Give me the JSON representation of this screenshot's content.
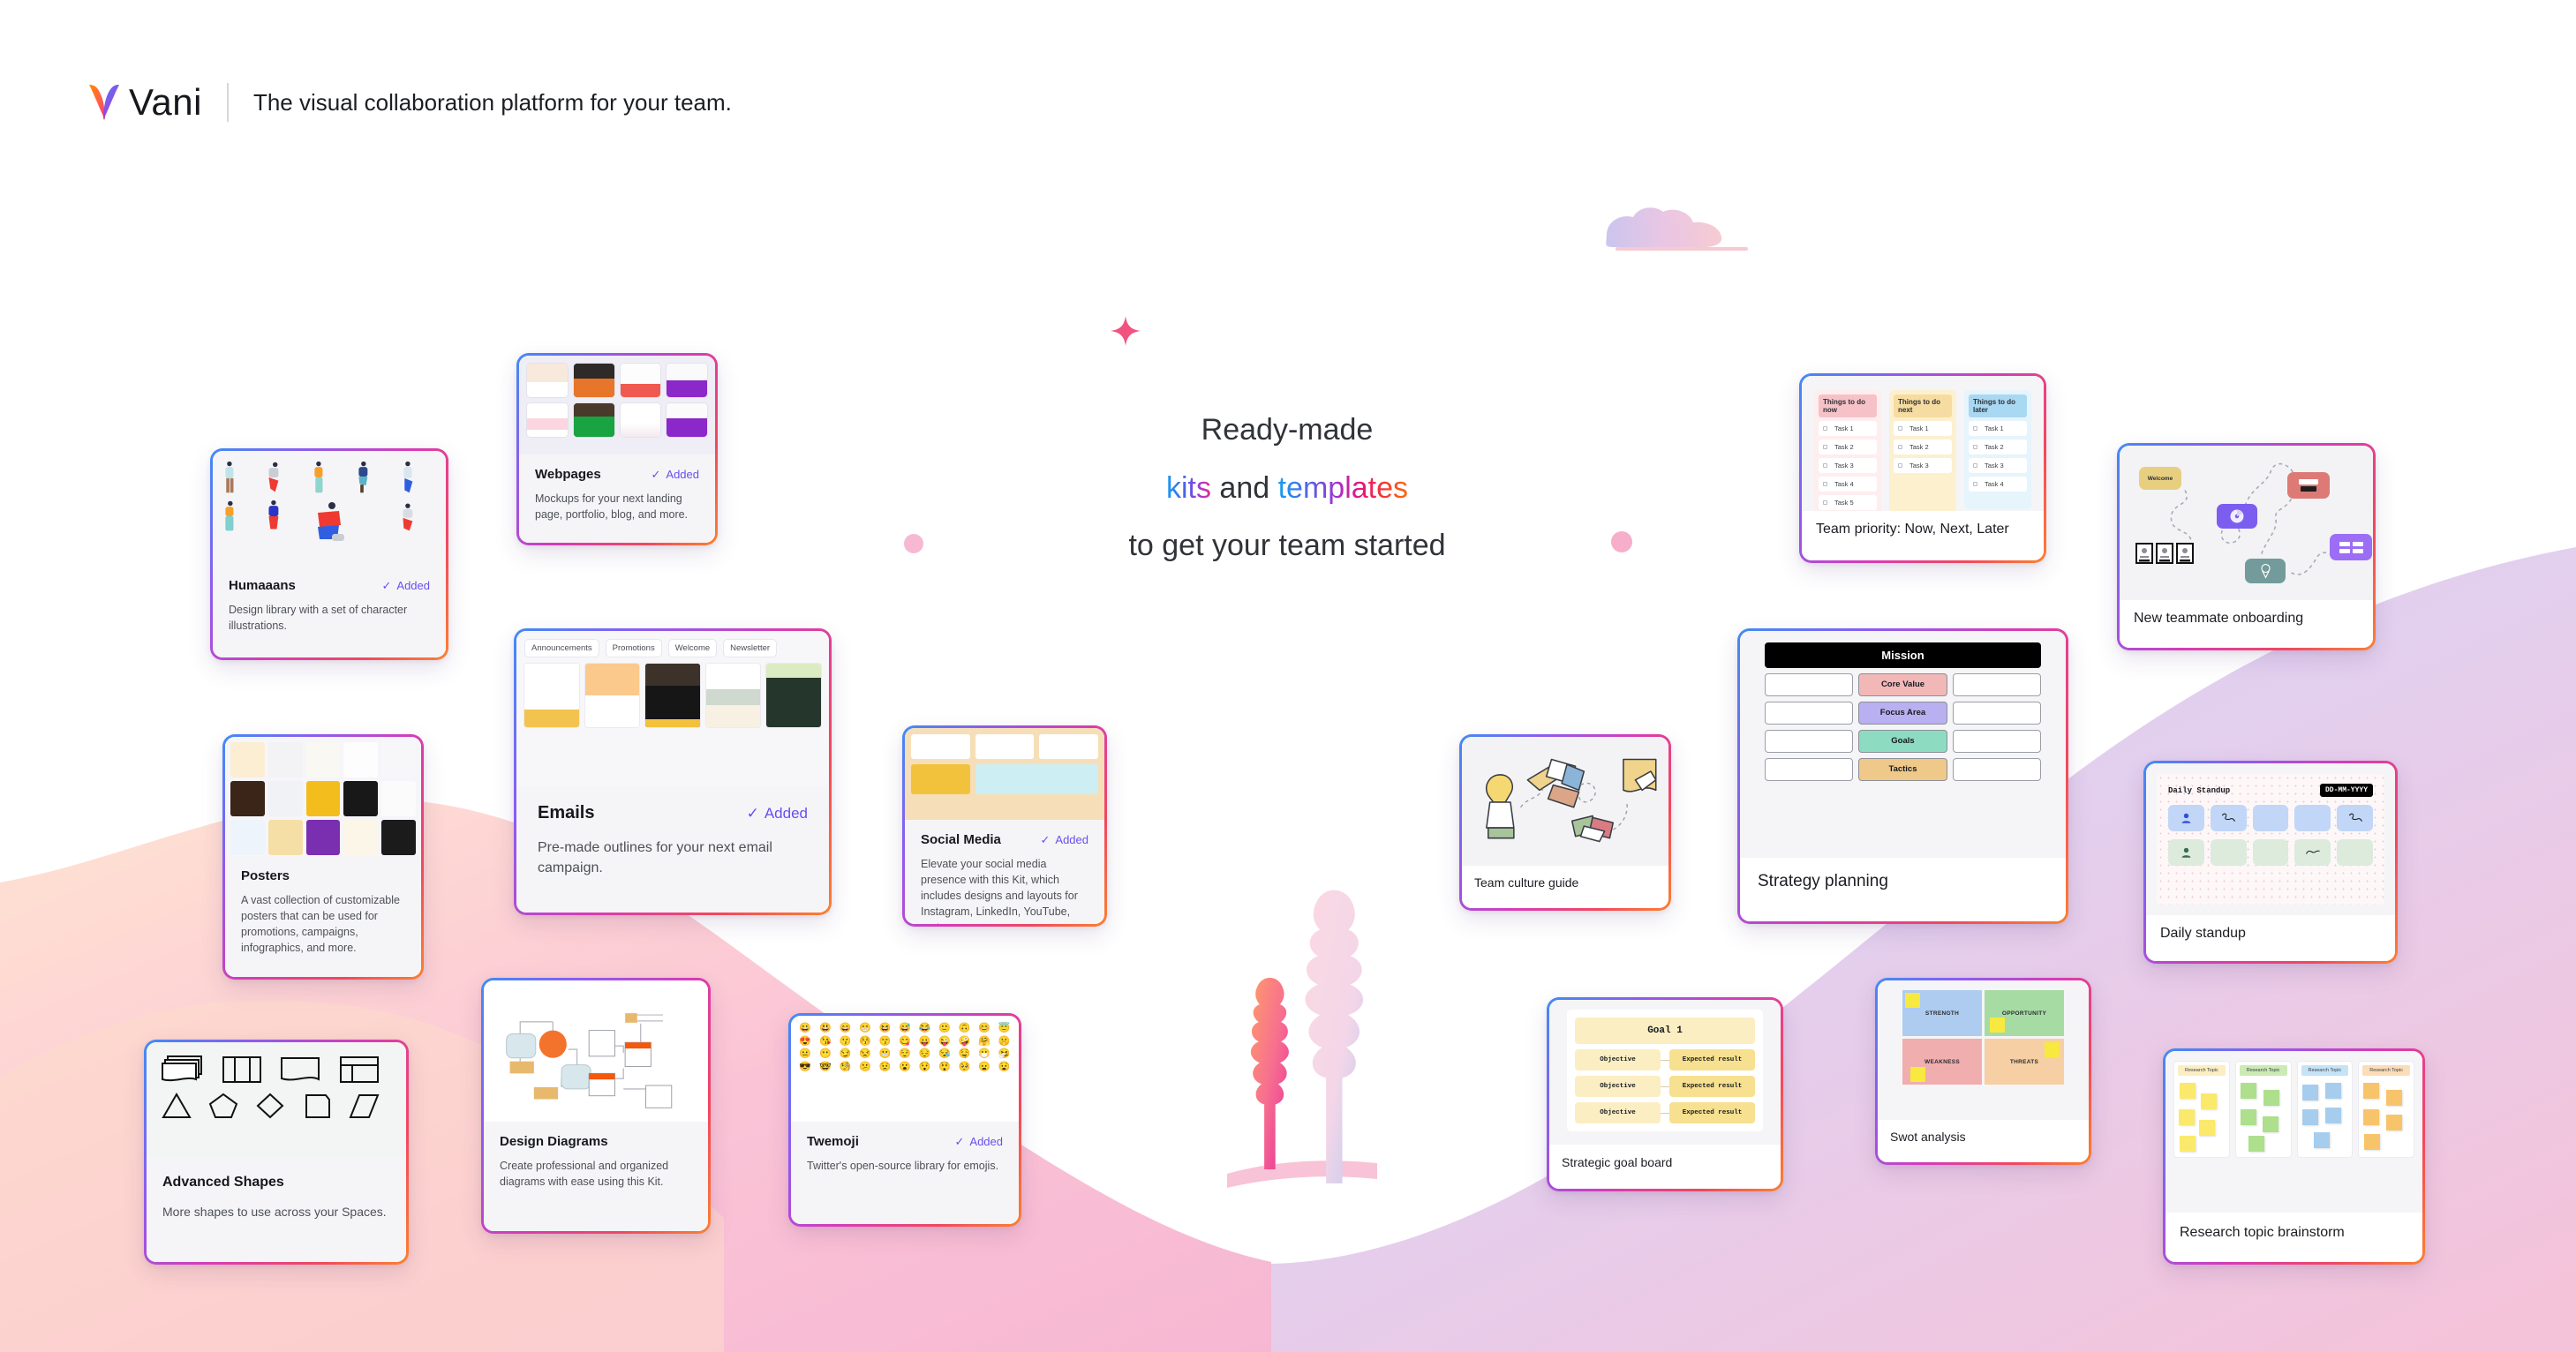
{
  "header": {
    "logo_text": "Vani",
    "tagline": "The visual collaboration platform for your team."
  },
  "hero": {
    "line1": "Ready-made",
    "line2_a": "kits",
    "line2_b": "and",
    "line2_c": "templates",
    "line3": "to get your team started"
  },
  "labels": {
    "added": "Added",
    "check": "✓"
  },
  "kits": [
    {
      "name": "humaaans",
      "title": "Humaaans",
      "desc": "Design library with a set of character illustrations.",
      "added": true
    },
    {
      "name": "webpages",
      "title": "Webpages",
      "desc": "Mockups for your next landing page, portfolio, blog, and more.",
      "added": true
    },
    {
      "name": "emails",
      "title": "Emails",
      "desc": "Pre-made outlines for your next email campaign.",
      "added": true,
      "tabs": [
        "Announcements",
        "Promotions",
        "Welcome",
        "Newsletter"
      ]
    },
    {
      "name": "posters",
      "title": "Posters",
      "desc": "A vast collection of customizable posters that can be used for promotions, campaigns, infographics, and more.",
      "added": false
    },
    {
      "name": "social-media",
      "title": "Social Media",
      "desc": "Elevate your social media presence with this Kit, which includes designs and layouts for Instagram, LinkedIn, YouTube, and more.",
      "added": true
    },
    {
      "name": "advanced-shapes",
      "title": "Advanced Shapes",
      "desc": "More shapes to use across your Spaces.",
      "added": false
    },
    {
      "name": "design-diagrams",
      "title": "Design Diagrams",
      "desc": "Create professional and organized diagrams with ease using this Kit.",
      "added": false
    },
    {
      "name": "twemoji",
      "title": "Twemoji",
      "desc": "Twitter's open-source library for emojis.",
      "added": true
    }
  ],
  "templates": [
    {
      "name": "team-priority",
      "title": "Team priority: Now, Next, Later"
    },
    {
      "name": "new-teammate-onboarding",
      "title": "New teammate onboarding"
    },
    {
      "name": "strategy-planning",
      "title": "Strategy planning"
    },
    {
      "name": "team-culture-guide",
      "title": "Team culture guide"
    },
    {
      "name": "daily-standup",
      "title": "Daily standup"
    },
    {
      "name": "strategic-goal-board",
      "title": "Strategic goal board"
    },
    {
      "name": "swot-analysis",
      "title": "Swot analysis"
    },
    {
      "name": "research-topic-brainstorm",
      "title": "Research topic brainstorm"
    }
  ],
  "priority_board": {
    "columns": [
      {
        "header": "Things to do now",
        "color": "#f6c2c8",
        "body": "#fdeef0",
        "tasks": [
          "Task 1",
          "Task 2",
          "Task 3",
          "Task 4",
          "Task 5"
        ]
      },
      {
        "header": "Things to do next",
        "color": "#f6dca0",
        "body": "#fdf0cf",
        "tasks": [
          "Task 1",
          "Task 2",
          "Task 3"
        ]
      },
      {
        "header": "Things to do later",
        "color": "#a9d8f2",
        "body": "#e6f4fc",
        "tasks": [
          "Task 1",
          "Task 2",
          "Task 3",
          "Task 4"
        ]
      }
    ]
  },
  "strategy": {
    "mission": "Mission",
    "rows": [
      {
        "label": "Core Value",
        "color": "#f2b8b8"
      },
      {
        "label": "Focus Area",
        "color": "#b8b0f0"
      },
      {
        "label": "Goals",
        "color": "#8ddcc2"
      },
      {
        "label": "Tactics",
        "color": "#efc98a"
      }
    ]
  },
  "daily_standup": {
    "title": "Daily Standup",
    "date_placeholder": "DD-MM-YYYY"
  },
  "goal_board": {
    "goal": "Goal 1",
    "rows": [
      {
        "objective": "Objective",
        "expected": "Expected result"
      },
      {
        "objective": "Objective",
        "expected": "Expected result"
      },
      {
        "objective": "Objective",
        "expected": "Expected result"
      }
    ]
  },
  "swot": {
    "quadrants": [
      {
        "label": "STRENGTH",
        "color": "#aecbf0"
      },
      {
        "label": "OPPORTUNITY",
        "color": "#a7dba4"
      },
      {
        "label": "WEAKNESS",
        "color": "#f0aeae"
      },
      {
        "label": "THREATS",
        "color": "#f7cfa4"
      }
    ]
  },
  "brainstorm": {
    "columns": [
      {
        "header": "Research Topic",
        "header_color": "#fbeec2",
        "note_color": "#fbe96b"
      },
      {
        "header": "Research Topic",
        "header_color": "#cbeab4",
        "note_color": "#addf8c"
      },
      {
        "header": "Research Topic",
        "header_color": "#c5e3f7",
        "note_color": "#a6cdee"
      },
      {
        "header": "Research Topic",
        "header_color": "#fbddb8",
        "note_color": "#f8c46b"
      }
    ]
  },
  "onboarding": {
    "welcome": "Welcome"
  },
  "colors": {
    "accent_purple": "#6b4df0",
    "card_border_gradient_start": "#3f8cf5",
    "card_border_gradient_end": "#fb8130",
    "bg_peach": "#fde4d6",
    "bg_pink": "#fbc6d8",
    "bg_lavender": "#d9d2f2"
  }
}
